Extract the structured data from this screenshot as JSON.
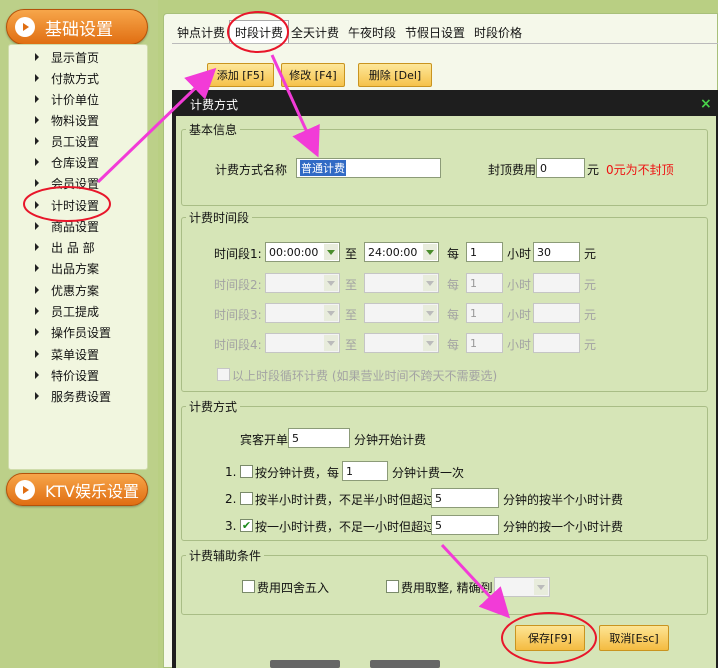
{
  "sidebar": {
    "category_basic": "基础设置",
    "category_ktv": "KTV娱乐设置",
    "items": [
      "显示首页",
      "付款方式",
      "计价单位",
      "物料设置",
      "员工设置",
      "仓库设置",
      "会员设置",
      "计时设置",
      "商品设置",
      "出 品 部",
      "出品方案",
      "优惠方案",
      "员工提成",
      "操作员设置",
      "菜单设置",
      "特价设置",
      "服务费设置"
    ]
  },
  "tabs": [
    "钟点计费",
    "时段计费",
    "全天计费",
    "午夜时段",
    "节假日设置",
    "时段价格"
  ],
  "toolbar": {
    "add": "添加 [F5]",
    "edit": "修改 [F4]",
    "delete": "删除 [Del]"
  },
  "dialog": {
    "title": "计费方式",
    "close": "×",
    "basic": {
      "title": "基本信息",
      "name_label": "计费方式名称",
      "name_value": "普通计费",
      "cap_label": "封顶费用",
      "cap_value": "0",
      "cap_unit": "元",
      "cap_hint": "0元为不封顶"
    },
    "periods": {
      "title": "计费时间段",
      "to": "至",
      "every": "每",
      "hour": "小时",
      "yuan": "元",
      "rows": [
        {
          "label": "时间段1:",
          "start": "00:00:00",
          "end": "24:00:00",
          "hours": "1",
          "price": "30"
        },
        {
          "label": "时间段2:",
          "start": "",
          "end": "",
          "hours": "1",
          "price": ""
        },
        {
          "label": "时间段3:",
          "start": "",
          "end": "",
          "hours": "1",
          "price": ""
        },
        {
          "label": "时间段4:",
          "start": "",
          "end": "",
          "hours": "1",
          "price": ""
        }
      ],
      "cycle_label": "以上时段循环计费 (如果营业时间不跨天不需要选)"
    },
    "method": {
      "title": "计费方式",
      "open_label": "宾客开单",
      "open_value": "5",
      "open_suffix": "分钟开始计费",
      "options": [
        {
          "num": "1.",
          "checked": "",
          "label": "按分钟计费，每",
          "value": "1",
          "suffix": "分钟计费一次"
        },
        {
          "num": "2.",
          "checked": "",
          "label": "按半小时计费，不足半小时但超过",
          "value": "5",
          "suffix": "分钟的按半个小时计费"
        },
        {
          "num": "3.",
          "checked": "✔",
          "label": "按一小时计费，不足一小时但超过",
          "value": "5",
          "suffix": "分钟的按一个小时计费"
        }
      ]
    },
    "aux": {
      "title": "计费辅助条件",
      "round_label": "费用四舍五入",
      "trunc_label": "费用取整, 精确到",
      "trunc_value": ""
    },
    "save": "保存[F9]",
    "cancel": "取消[Esc]"
  }
}
